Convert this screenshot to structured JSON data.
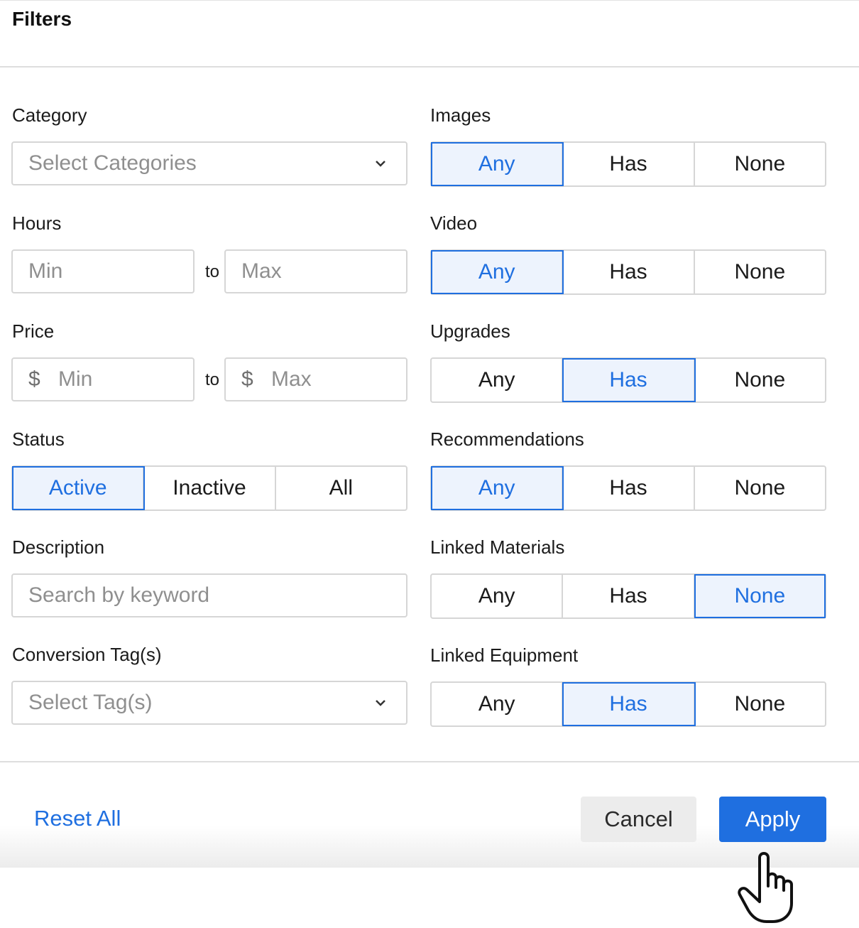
{
  "header": {
    "title": "Filters"
  },
  "left": {
    "category": {
      "label": "Category",
      "placeholder": "Select Categories"
    },
    "hours": {
      "label": "Hours",
      "min_placeholder": "Min",
      "to": "to",
      "max_placeholder": "Max"
    },
    "price": {
      "label": "Price",
      "currency": "$",
      "min_placeholder": "Min",
      "to": "to",
      "max_placeholder": "Max"
    },
    "status": {
      "label": "Status",
      "options": [
        "Active",
        "Inactive",
        "All"
      ],
      "selected": "Active"
    },
    "description": {
      "label": "Description",
      "placeholder": "Search by keyword"
    },
    "conversion_tags": {
      "label": "Conversion Tag(s)",
      "placeholder": "Select Tag(s)"
    }
  },
  "right": {
    "images": {
      "label": "Images",
      "options": [
        "Any",
        "Has",
        "None"
      ],
      "selected": "Any"
    },
    "video": {
      "label": "Video",
      "options": [
        "Any",
        "Has",
        "None"
      ],
      "selected": "Any"
    },
    "upgrades": {
      "label": "Upgrades",
      "options": [
        "Any",
        "Has",
        "None"
      ],
      "selected": "Has"
    },
    "recommendations": {
      "label": "Recommendations",
      "options": [
        "Any",
        "Has",
        "None"
      ],
      "selected": "Any"
    },
    "linked_materials": {
      "label": "Linked Materials",
      "options": [
        "Any",
        "Has",
        "None"
      ],
      "selected": "None"
    },
    "linked_equipment": {
      "label": "Linked Equipment",
      "options": [
        "Any",
        "Has",
        "None"
      ],
      "selected": "Has"
    }
  },
  "footer": {
    "reset_label": "Reset All",
    "cancel_label": "Cancel",
    "apply_label": "Apply"
  },
  "colors": {
    "accent": "#1f6fe0",
    "selected_bg": "#edf3fd",
    "border": "#d6d6d6"
  },
  "icons": {
    "dropdown": "chevron-down-icon",
    "pointer": "hand-pointer-icon"
  }
}
